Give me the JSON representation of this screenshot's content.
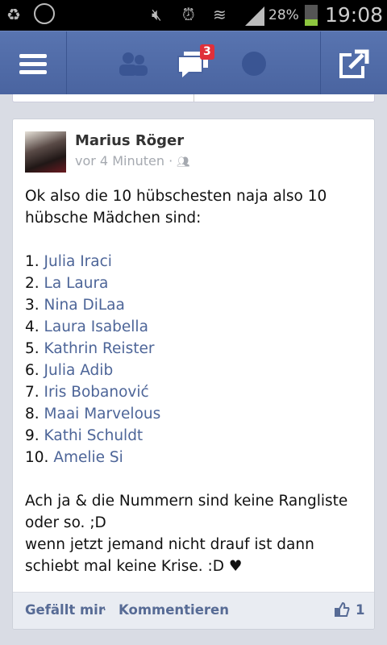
{
  "status_bar": {
    "battery": "28%",
    "time": "19:08",
    "battery_level": 0.28
  },
  "nav": {
    "messages_badge": "3"
  },
  "post": {
    "author": "Marius Röger",
    "time": "vor 4 Minuten",
    "separator": "·",
    "intro": [
      "Ok also die 10 hübschesten naja also 10",
      "hübsche Mädchen sind:"
    ],
    "list": [
      {
        "num": "1.",
        "name": "Julia Iraci"
      },
      {
        "num": "2.",
        "name": "La Laura"
      },
      {
        "num": "3.",
        "name": "Nina DiLaa"
      },
      {
        "num": "4.",
        "name": "Laura Isabella"
      },
      {
        "num": "5.",
        "name": "Kathrin Reister"
      },
      {
        "num": "6.",
        "name": "Julia Adib"
      },
      {
        "num": "7.",
        "name": "Iris Bobanović"
      },
      {
        "num": "8.",
        "name": "Maai Marvelous"
      },
      {
        "num": "9.",
        "name": "Kathi Schuldt"
      },
      {
        "num": "10.",
        "name": "Amelie Si"
      }
    ],
    "outro": [
      "Ach ja & die Nummern sind keine Rangliste",
      "oder so. ;D",
      "wenn jetzt jemand nicht drauf ist dann",
      "schiebt mal keine Krise. :D ♥"
    ]
  },
  "footer": {
    "like": "Gefällt mir",
    "dot": "·",
    "comment": "Kommentieren",
    "like_count": "1"
  }
}
